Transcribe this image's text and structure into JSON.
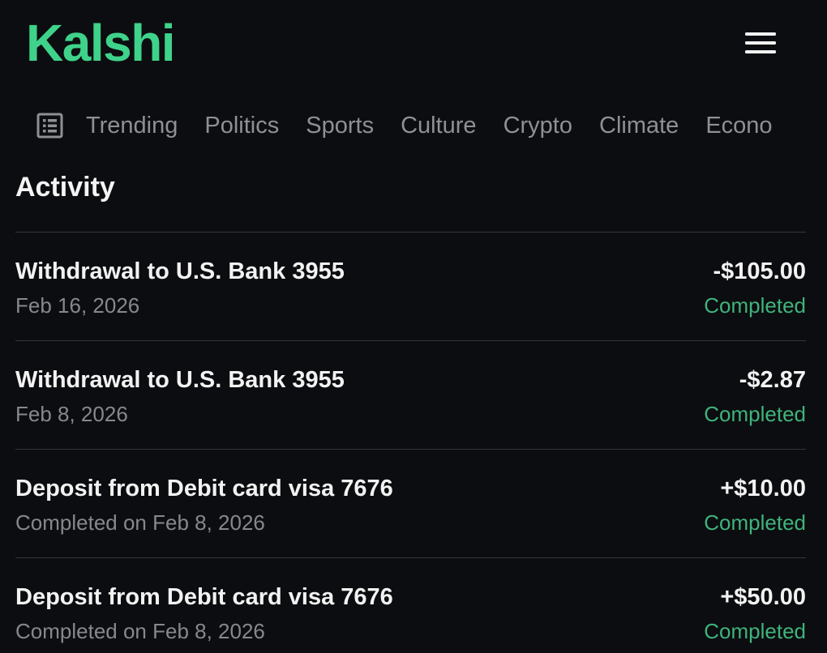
{
  "header": {
    "logo_text": "Kalshi",
    "menu_icon": "hamburger-menu-icon"
  },
  "categories": {
    "icon": "list-view-icon",
    "items": [
      {
        "label": "Trending"
      },
      {
        "label": "Politics"
      },
      {
        "label": "Sports"
      },
      {
        "label": "Culture"
      },
      {
        "label": "Crypto"
      },
      {
        "label": "Climate"
      },
      {
        "label": "Econo"
      }
    ]
  },
  "activity": {
    "title": "Activity",
    "items": [
      {
        "title": "Withdrawal to U.S. Bank 3955",
        "subtitle": "Feb 16, 2026",
        "amount": "-$105.00",
        "status": "Completed"
      },
      {
        "title": "Withdrawal to U.S. Bank 3955",
        "subtitle": "Feb 8, 2026",
        "amount": "-$2.87",
        "status": "Completed"
      },
      {
        "title": "Deposit from Debit card visa 7676",
        "subtitle": "Completed on Feb 8, 2026",
        "amount": "+$10.00",
        "status": "Completed"
      },
      {
        "title": "Deposit from Debit card visa 7676",
        "subtitle": "Completed on Feb 8, 2026",
        "amount": "+$50.00",
        "status": "Completed"
      }
    ]
  },
  "colors": {
    "background": "#0c0d10",
    "brand": "#3fd28a",
    "status_completed": "#3fb37c",
    "muted_text": "#8e9093",
    "divider": "#34363a"
  }
}
